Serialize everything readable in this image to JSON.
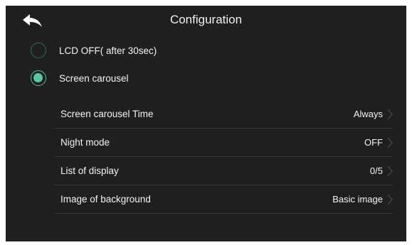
{
  "header": {
    "title": "Configuration",
    "back_icon": "back-arrow-icon"
  },
  "options": [
    {
      "label": "LCD OFF( after 30sec)",
      "selected": false
    },
    {
      "label": "Screen carousel",
      "selected": true
    }
  ],
  "settings": [
    {
      "label": "Screen carousel Time",
      "value": "Always"
    },
    {
      "label": "Night mode",
      "value": "OFF"
    },
    {
      "label": "List of display",
      "value": "0/5"
    },
    {
      "label": "Image of background",
      "value": "Basic image"
    }
  ],
  "colors": {
    "background": "#1f1f1f",
    "accent": "#55c89d",
    "text": "#f4f4f4",
    "divider": "#3a3a3a"
  }
}
